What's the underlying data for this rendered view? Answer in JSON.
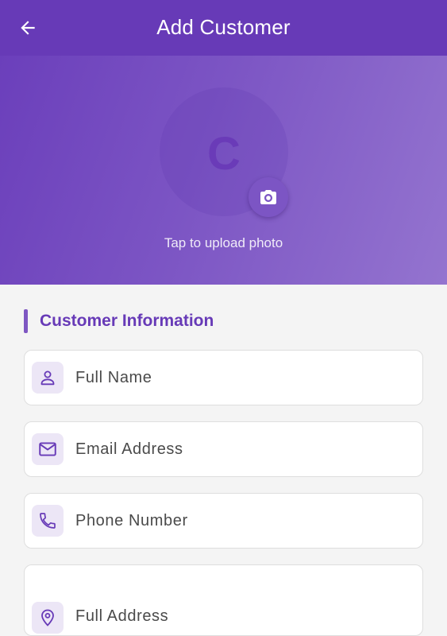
{
  "app_bar": {
    "title": "Add Customer",
    "back_icon": "arrow-left-icon",
    "background": "#673ab7"
  },
  "header": {
    "avatar_initial": "C",
    "camera_icon": "camera-icon",
    "upload_hint": "Tap to upload photo"
  },
  "section": {
    "title": "Customer Information",
    "accent": "#7e57c2"
  },
  "fields": [
    {
      "icon": "person-icon",
      "placeholder": "Full Name",
      "value": ""
    },
    {
      "icon": "mail-icon",
      "placeholder": "Email Address",
      "value": ""
    },
    {
      "icon": "phone-icon",
      "placeholder": "Phone Number",
      "value": ""
    },
    {
      "icon": "location-pin-icon",
      "placeholder": "Full Address",
      "value": ""
    }
  ]
}
